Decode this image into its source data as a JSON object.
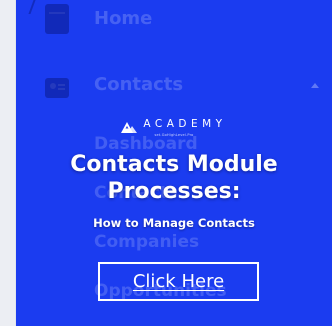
{
  "background_menu": {
    "home_label": "Home",
    "contacts_label": "Contacts",
    "sub_items": [
      "Dashboard",
      "Contacts",
      "Companies",
      "Opportunities"
    ]
  },
  "brand": {
    "name": "ACADEMY",
    "tagline": "set.GoHighLevel.Pro",
    "logo_icon": "mountain-logo-icon"
  },
  "headline": {
    "line1": "Contacts Module",
    "line2": "Processes:"
  },
  "subheadline": "How to Manage Contacts",
  "cta_label": "Click Here",
  "colors": {
    "card_background": "#1b3cf0",
    "text": "#ffffff",
    "page_background": "#eef0f4"
  }
}
